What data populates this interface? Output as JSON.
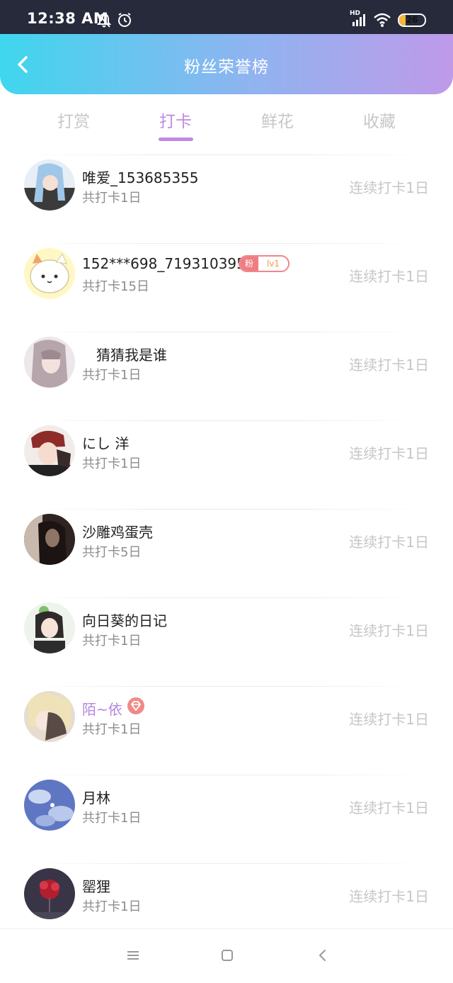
{
  "status_bar": {
    "time": "12:38 AM",
    "battery_level": "26",
    "battery_percent": 26,
    "network_badge": "HD",
    "icons": [
      "bell-muted-icon",
      "alarm-icon",
      "signal-icon",
      "wifi-icon",
      "battery-icon"
    ]
  },
  "header": {
    "title": "粉丝荣誉榜",
    "back_icon": "chevron-left-icon",
    "gradient": [
      "#3fd6ee",
      "#8fb4f0",
      "#bf9ae9"
    ]
  },
  "tabs": [
    {
      "label": "打赏",
      "active": false
    },
    {
      "label": "打卡",
      "active": true
    },
    {
      "label": "鲜花",
      "active": false
    },
    {
      "label": "收藏",
      "active": false
    }
  ],
  "accent_color": "#c08ae2",
  "ranking": [
    {
      "name": "唯爱_153685355",
      "total": "共打卡1日",
      "streak": "连续打卡1日"
    },
    {
      "name": "152***698_719310395",
      "total": "共打卡15日",
      "streak": "连续打卡1日",
      "badge": {
        "left": "粉",
        "right": "lv1"
      }
    },
    {
      "name": "猜猜我是谁",
      "total": "共打卡1日",
      "streak": "连续打卡1日"
    },
    {
      "name": "にし 洋",
      "total": "共打卡1日",
      "streak": "连续打卡1日"
    },
    {
      "name": "沙雕鸡蛋壳",
      "total": "共打卡5日",
      "streak": "连续打卡1日"
    },
    {
      "name": "向日葵的日记",
      "total": "共打卡1日",
      "streak": "连续打卡1日"
    },
    {
      "name": "陌~依",
      "total": "共打卡1日",
      "streak": "连续打卡1日",
      "vip_icon": "diamond-icon"
    },
    {
      "name": "月林",
      "total": "共打卡1日",
      "streak": "连续打卡1日"
    },
    {
      "name": "罂狸",
      "total": "共打卡1日",
      "streak": "连续打卡1日"
    }
  ],
  "bottom_nav": {
    "icons": [
      "menu-icon",
      "home-square-icon",
      "back-arrow-icon"
    ]
  }
}
